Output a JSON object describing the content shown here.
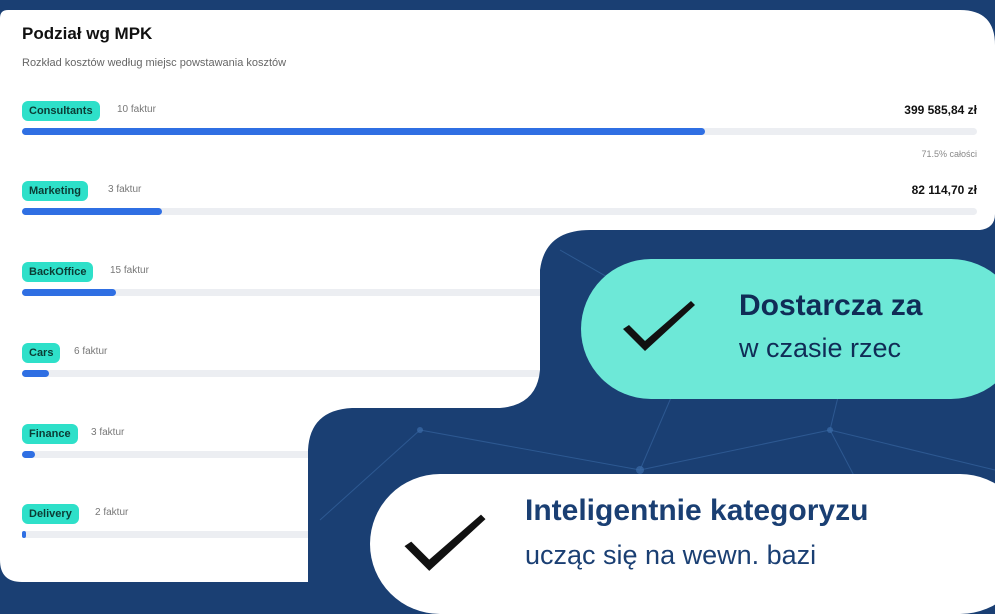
{
  "card": {
    "title": "Podział wg MPK",
    "subtitle": "Rozkład kosztów według miejsc powstawania kosztów",
    "rows": [
      {
        "label": "Consultants",
        "count": "10 faktur",
        "amount": "399 585,84 zł",
        "share": "71.5% całości",
        "fill": 0.715
      },
      {
        "label": "Marketing",
        "count": "3 faktur",
        "amount": "82 114,70 zł",
        "share": "",
        "fill": 0.147
      },
      {
        "label": "BackOffice",
        "count": "15 faktur",
        "amount": "",
        "share": "",
        "fill": 0.098
      },
      {
        "label": "Cars",
        "count": "6 faktur",
        "amount": "",
        "share": "",
        "fill": 0.028
      },
      {
        "label": "Finance",
        "count": "3 faktur",
        "amount": "",
        "share": "",
        "fill": 0.014
      },
      {
        "label": "Delivery",
        "count": "2 faktur",
        "amount": "",
        "share": "",
        "fill": 0.003
      }
    ]
  },
  "features": [
    {
      "strong": "Dostarcza za",
      "text": "w czasie rzec"
    },
    {
      "strong": "Inteligentnie kategoryzu",
      "text": "ucząc się na wewn. bazi"
    }
  ],
  "colors": {
    "background": "#1a3f73",
    "pill": "#6de8d7",
    "tag": "#2ee0c9",
    "bar": "#2f6fe3"
  },
  "icons": [
    "check-icon"
  ]
}
